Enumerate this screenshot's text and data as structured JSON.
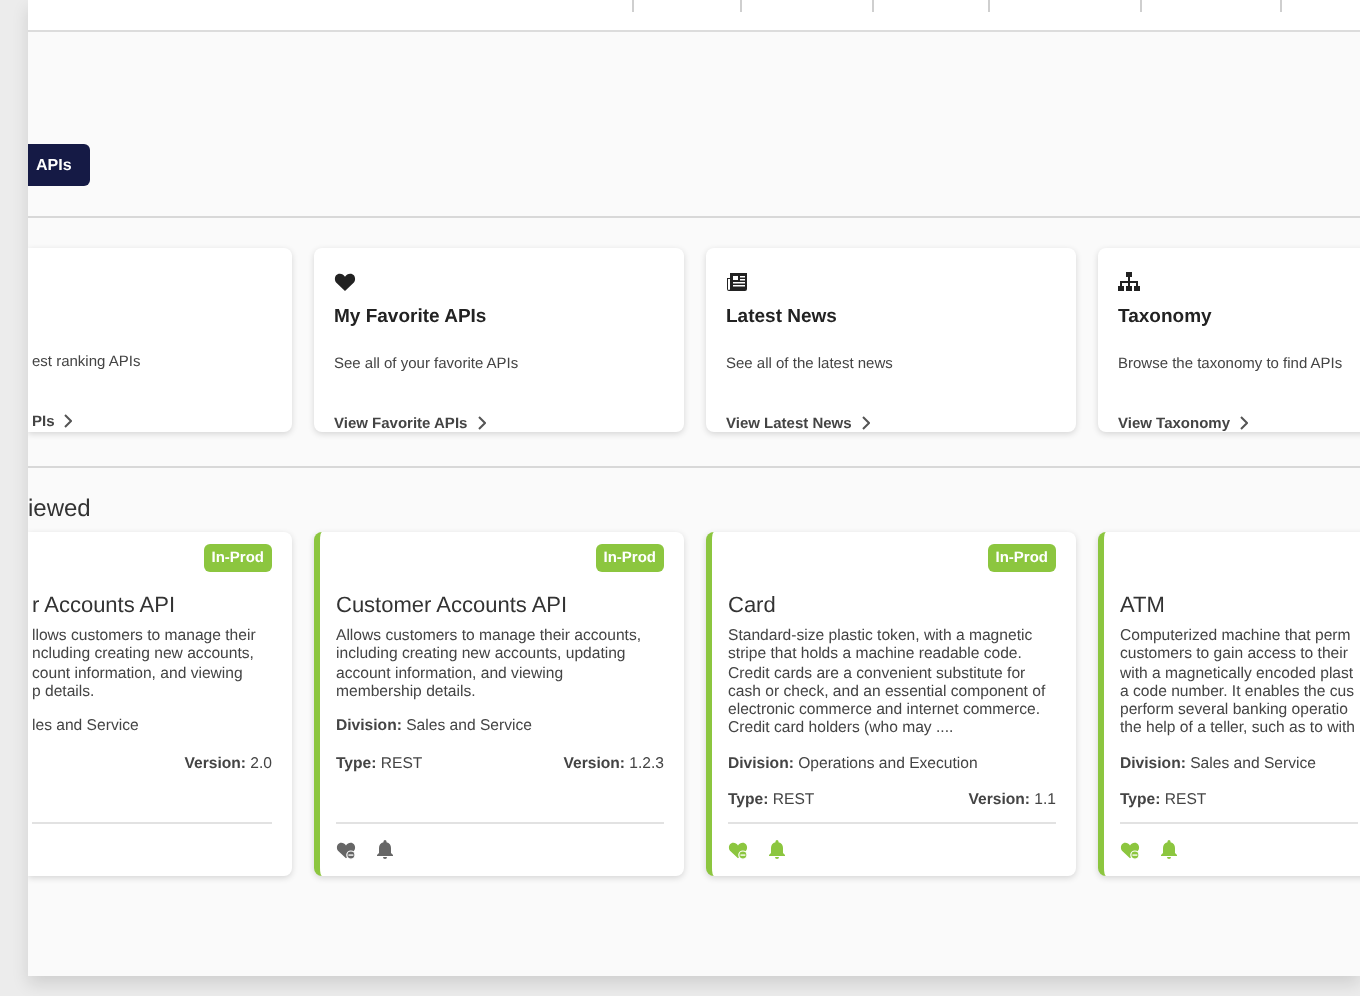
{
  "toolbar_button": {
    "label": "APIs"
  },
  "quick_links": [
    {
      "kind": "partial",
      "description": "est ranking APIs",
      "link": "PIs"
    },
    {
      "kind": "favorites",
      "title": "My Favorite APIs",
      "description": "See all of your favorite APIs",
      "link": "View Favorite APIs"
    },
    {
      "kind": "news",
      "title": "Latest News",
      "description": "See all of the latest news",
      "link": "View Latest News"
    },
    {
      "kind": "taxonomy",
      "title": "Taxonomy",
      "description": "Browse the taxonomy to find APIs",
      "link": "View Taxonomy"
    }
  ],
  "section_heading": "iewed",
  "api_cards": [
    {
      "accent": false,
      "badge": "In-Prod",
      "title": "r Accounts API",
      "description_lines": [
        "llows customers to manage their",
        "ncluding creating new accounts,",
        "count information, and viewing",
        "p details."
      ],
      "division": "les and Service",
      "version": "**Version:** 2.0"
    },
    {
      "accent": true,
      "badge": "In-Prod",
      "title": "Customer Accounts API",
      "description_lines": [
        "Allows customers to manage their accounts,",
        "including creating new accounts, updating",
        "account information, and viewing",
        "membership details."
      ],
      "division": "**Division:** Sales and Service",
      "type": "**Type:** REST",
      "version": "**Version:** 1.2.3",
      "actions_active": false
    },
    {
      "accent": true,
      "badge": "In-Prod",
      "title": "Card",
      "description_lines": [
        "Standard-size plastic token, with a magnetic",
        "stripe that holds a machine readable code.",
        "Credit cards are a convenient substitute for",
        "cash or check, and an essential component of",
        "electronic commerce and internet commerce.",
        "Credit card holders (who may ...."
      ],
      "division": "**Division:** Operations and Execution",
      "type": "**Type:** REST",
      "version": "**Version:** 1.1",
      "actions_active": true
    },
    {
      "accent": true,
      "title": "ATM",
      "description_lines": [
        "Computerized machine that perm",
        "customers to gain access to their",
        "with a magnetically encoded plast",
        "a code number. It enables the cus",
        "perform several banking operatio",
        "the help of a teller, such as to with"
      ],
      "division": "**Division:** Sales and Service",
      "type": "**Type:** REST",
      "actions_active": true
    }
  ]
}
